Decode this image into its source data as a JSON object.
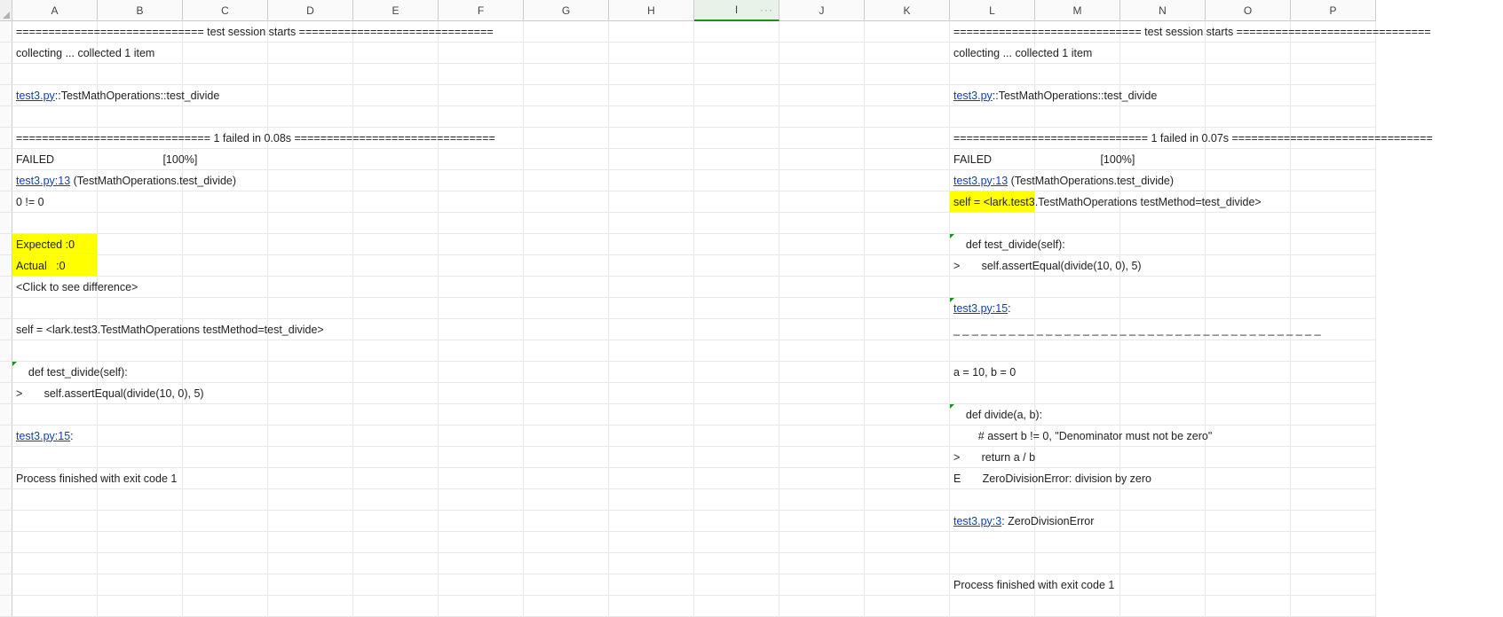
{
  "columns": [
    "A",
    "B",
    "C",
    "D",
    "E",
    "F",
    "G",
    "H",
    "I",
    "J",
    "K",
    "L",
    "M",
    "N",
    "O",
    "P"
  ],
  "selected_column_index": 8,
  "selected_column_dots": "···",
  "left": {
    "session_start": "============================= test session starts ==============================",
    "collecting": "collecting ... collected 1 item",
    "path_line_link": "test3.py",
    "path_line_rest": "::TestMathOperations::test_divide",
    "failed_line": "============================== 1 failed in 0.08s ===============================",
    "failed_cell": "FAILED",
    "pct_cell": "                    [100%]",
    "tblink2": "test3.py:13",
    "tblink2_rest": " (TestMathOperations.test_divide)",
    "neq": "0 != 0",
    "expected": "Expected :0",
    "actual": "Actual   :0",
    "clickdiff": "<Click to see difference>",
    "selfline": "self = <lark.test3.TestMathOperations testMethod=test_divide>",
    "def_line": "    def test_divide(self):",
    "assert_line": ">       self.assertEqual(divide(10, 0), 5)",
    "tblink3": "test3.py:15",
    "tblink3_rest": ": ",
    "proc": "Process finished with exit code 1"
  },
  "right": {
    "session_start": "============================= test session starts ==============================",
    "collecting": "collecting ... collected 1 item",
    "path_line_link": "test3.py",
    "path_line_rest": "::TestMathOperations::test_divide",
    "failed_line": "============================== 1 failed in 0.07s ===============================",
    "failed_cell": "FAILED",
    "pct_cell": "                    [100%]",
    "tblink2": "test3.py:13",
    "tblink2_rest": " (TestMathOperations.test_divide)",
    "selfline": "self = <lark.test3.TestMathOperations testMethod=test_divide>",
    "def_line": "    def test_divide(self):",
    "assert_line": ">       self.assertEqual(divide(10, 0), 5)",
    "tblink3": "test3.py:15",
    "tblink3_rest": ": ",
    "dashes": "_ _ _ _ _ _ _ _ _ _ _ _ _ _ _ _ _ _ _ _ _ _ _ _ _ _ _ _ _ _ _ _ _ _ _ _ _ _ _ _",
    "ab": "a = 10, b = 0",
    "def_div": "    def divide(a, b):",
    "assert_b": "        # assert b != 0, \"Denominator must not be zero\"",
    "return_line": ">       return a / b",
    "err_line": "E       ZeroDivisionError: division by zero",
    "tblink4": "test3.py:3",
    "tblink4_rest": ": ZeroDivisionError",
    "proc": "Process finished with exit code 1"
  }
}
